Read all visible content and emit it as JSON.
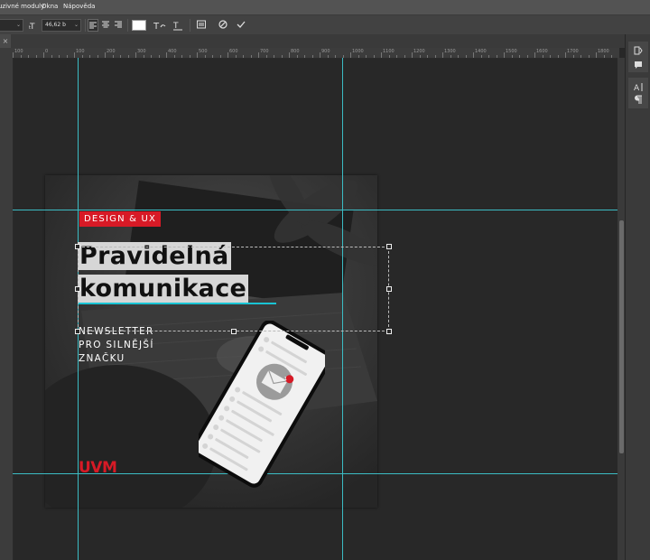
{
  "menubar": {
    "items": [
      "uzivné moduly",
      "Okna",
      "Nápověda"
    ]
  },
  "options_bar": {
    "font_size_value": "46,62 b",
    "icons": [
      "font-style-dropdown",
      "font-size-icon",
      "align-left-icon",
      "align-center-icon",
      "align-right-icon",
      "text-color-swatch",
      "warp-text-icon",
      "text-orientation-icon",
      "character-panel-icon",
      "cancel-icon",
      "commit-icon"
    ]
  },
  "ruler": {
    "labels": [
      "100",
      "0",
      "100",
      "200",
      "300",
      "400",
      "500",
      "600",
      "700",
      "800",
      "900",
      "1000",
      "1100",
      "1200",
      "1300",
      "1400",
      "1500",
      "1600",
      "1700",
      "1800"
    ]
  },
  "artwork": {
    "tag_label": "DESIGN & UX",
    "headline_line1": "Pravidelná",
    "headline_line2": "komunikace",
    "subtitle_lines": [
      "NEWSLETTER",
      "PRO SILNĚJŠÍ",
      "ZNAČKU"
    ],
    "logo_text": "UVM",
    "notification_count": "1",
    "colors": {
      "accent_red": "#d71a26",
      "highlight_gray": "#d6d6d6",
      "guide_cyan": "#3bbcc4",
      "underline_cyan": "#19c4d4"
    }
  },
  "right_panel": {
    "icons": [
      "history-icon",
      "comment-icon",
      "character-icon",
      "paragraph-icon"
    ]
  }
}
